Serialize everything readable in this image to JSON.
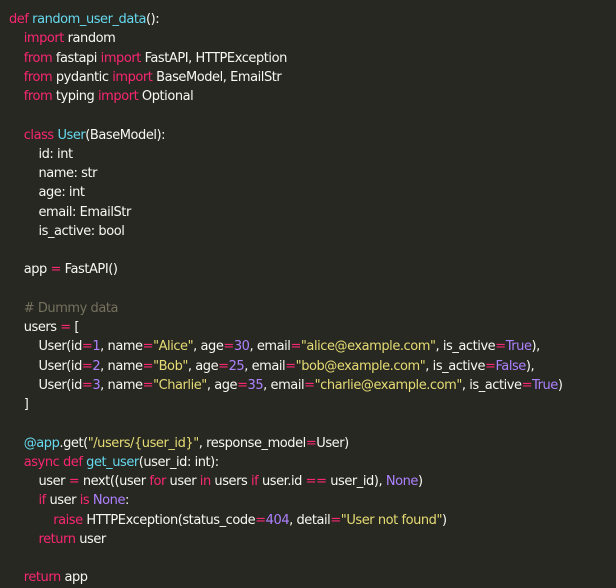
{
  "theme": {
    "background": "#272822",
    "text": "#f8f8f2",
    "keyword": "#f92672",
    "name": "#66d9ef",
    "string": "#e6db74",
    "number": "#ae81ff",
    "comment": "#75715e"
  },
  "code": {
    "lines": [
      [
        [
          "kw",
          "def "
        ],
        [
          "fn",
          "random_user_data"
        ],
        [
          "pl",
          "():"
        ]
      ],
      [
        [
          "pl",
          "    "
        ],
        [
          "kw",
          "import "
        ],
        [
          "pl",
          "random"
        ]
      ],
      [
        [
          "pl",
          "    "
        ],
        [
          "kw",
          "from "
        ],
        [
          "pl",
          "fastapi "
        ],
        [
          "kw",
          "import "
        ],
        [
          "pl",
          "FastAPI, HTTPException"
        ]
      ],
      [
        [
          "pl",
          "    "
        ],
        [
          "kw",
          "from "
        ],
        [
          "pl",
          "pydantic "
        ],
        [
          "kw",
          "import "
        ],
        [
          "pl",
          "BaseModel, EmailStr"
        ]
      ],
      [
        [
          "pl",
          "    "
        ],
        [
          "kw",
          "from "
        ],
        [
          "pl",
          "typing "
        ],
        [
          "kw",
          "import "
        ],
        [
          "pl",
          "Optional"
        ]
      ],
      [
        [
          "pl",
          ""
        ]
      ],
      [
        [
          "pl",
          "    "
        ],
        [
          "kw",
          "class "
        ],
        [
          "fn",
          "User"
        ],
        [
          "pl",
          "(BaseModel):"
        ]
      ],
      [
        [
          "pl",
          "        id: int"
        ]
      ],
      [
        [
          "pl",
          "        name: str"
        ]
      ],
      [
        [
          "pl",
          "        age: int"
        ]
      ],
      [
        [
          "pl",
          "        email: EmailStr"
        ]
      ],
      [
        [
          "pl",
          "        is_active: bool"
        ]
      ],
      [
        [
          "pl",
          ""
        ]
      ],
      [
        [
          "pl",
          "    app "
        ],
        [
          "kw",
          "= "
        ],
        [
          "pl",
          "FastAPI()"
        ]
      ],
      [
        [
          "pl",
          ""
        ]
      ],
      [
        [
          "cm",
          "    # Dummy data"
        ]
      ],
      [
        [
          "pl",
          "    users "
        ],
        [
          "kw",
          "= "
        ],
        [
          "pl",
          "["
        ]
      ],
      [
        [
          "pl",
          "        User(id"
        ],
        [
          "kw",
          "="
        ],
        [
          "nu",
          "1"
        ],
        [
          "pl",
          ", name"
        ],
        [
          "kw",
          "="
        ],
        [
          "st",
          "\"Alice\""
        ],
        [
          "pl",
          ", age"
        ],
        [
          "kw",
          "="
        ],
        [
          "nu",
          "30"
        ],
        [
          "pl",
          ", email"
        ],
        [
          "kw",
          "="
        ],
        [
          "st",
          "\"alice@example.com\""
        ],
        [
          "pl",
          ", is_active"
        ],
        [
          "kw",
          "="
        ],
        [
          "nu",
          "True"
        ],
        [
          "pl",
          "),"
        ]
      ],
      [
        [
          "pl",
          "        User(id"
        ],
        [
          "kw",
          "="
        ],
        [
          "nu",
          "2"
        ],
        [
          "pl",
          ", name"
        ],
        [
          "kw",
          "="
        ],
        [
          "st",
          "\"Bob\""
        ],
        [
          "pl",
          ", age"
        ],
        [
          "kw",
          "="
        ],
        [
          "nu",
          "25"
        ],
        [
          "pl",
          ", email"
        ],
        [
          "kw",
          "="
        ],
        [
          "st",
          "\"bob@example.com\""
        ],
        [
          "pl",
          ", is_active"
        ],
        [
          "kw",
          "="
        ],
        [
          "nu",
          "False"
        ],
        [
          "pl",
          "),"
        ]
      ],
      [
        [
          "pl",
          "        User(id"
        ],
        [
          "kw",
          "="
        ],
        [
          "nu",
          "3"
        ],
        [
          "pl",
          ", name"
        ],
        [
          "kw",
          "="
        ],
        [
          "st",
          "\"Charlie\""
        ],
        [
          "pl",
          ", age"
        ],
        [
          "kw",
          "="
        ],
        [
          "nu",
          "35"
        ],
        [
          "pl",
          ", email"
        ],
        [
          "kw",
          "="
        ],
        [
          "st",
          "\"charlie@example.com\""
        ],
        [
          "pl",
          ", is_active"
        ],
        [
          "kw",
          "="
        ],
        [
          "nu",
          "True"
        ],
        [
          "pl",
          ")"
        ]
      ],
      [
        [
          "pl",
          "    ]"
        ]
      ],
      [
        [
          "pl",
          ""
        ]
      ],
      [
        [
          "pl",
          "    "
        ],
        [
          "fn",
          "@app"
        ],
        [
          "pl",
          ".get("
        ],
        [
          "st",
          "\"/users/{user_id}\""
        ],
        [
          "pl",
          ", response_model"
        ],
        [
          "kw",
          "="
        ],
        [
          "pl",
          "User)"
        ]
      ],
      [
        [
          "pl",
          "    "
        ],
        [
          "kw",
          "async def "
        ],
        [
          "fn",
          "get_user"
        ],
        [
          "pl",
          "(user_id: int):"
        ]
      ],
      [
        [
          "pl",
          "        user "
        ],
        [
          "kw",
          "= "
        ],
        [
          "pl",
          "next((user "
        ],
        [
          "kw",
          "for "
        ],
        [
          "pl",
          "user "
        ],
        [
          "kw",
          "in "
        ],
        [
          "pl",
          "users "
        ],
        [
          "kw",
          "if "
        ],
        [
          "pl",
          "user.id "
        ],
        [
          "kw",
          "== "
        ],
        [
          "pl",
          "user_id), "
        ],
        [
          "nu",
          "None"
        ],
        [
          "pl",
          ")"
        ]
      ],
      [
        [
          "pl",
          "        "
        ],
        [
          "kw",
          "if "
        ],
        [
          "pl",
          "user "
        ],
        [
          "kw",
          "is "
        ],
        [
          "nu",
          "None"
        ],
        [
          "pl",
          ":"
        ]
      ],
      [
        [
          "pl",
          "            "
        ],
        [
          "kw",
          "raise "
        ],
        [
          "pl",
          "HTTPException(status_code"
        ],
        [
          "kw",
          "="
        ],
        [
          "nu",
          "404"
        ],
        [
          "pl",
          ", detail"
        ],
        [
          "kw",
          "="
        ],
        [
          "st",
          "\"User not found\""
        ],
        [
          "pl",
          ")"
        ]
      ],
      [
        [
          "pl",
          "        "
        ],
        [
          "kw",
          "return "
        ],
        [
          "pl",
          "user"
        ]
      ],
      [
        [
          "pl",
          ""
        ]
      ],
      [
        [
          "pl",
          "    "
        ],
        [
          "kw",
          "return "
        ],
        [
          "pl",
          "app"
        ]
      ]
    ]
  }
}
